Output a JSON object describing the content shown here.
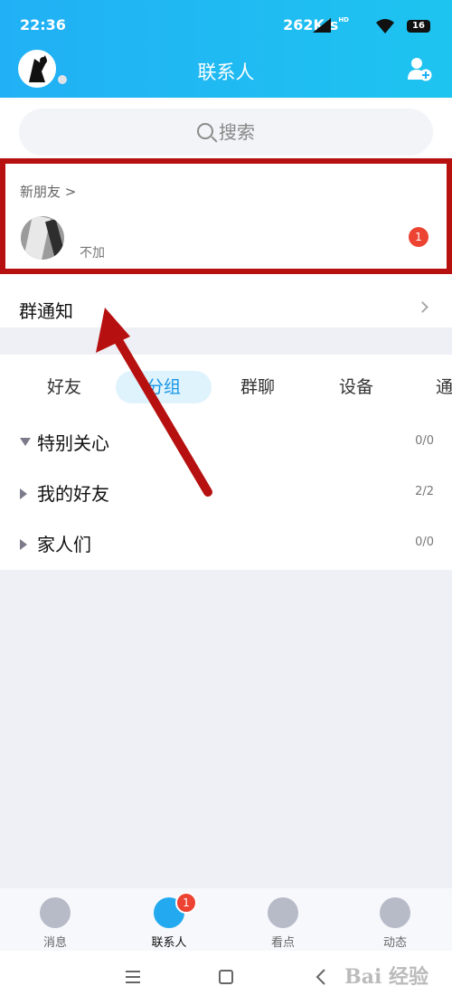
{
  "status_bar": {
    "time": "22:36",
    "speed": "262K/s",
    "hd": "HD",
    "battery": "16"
  },
  "header": {
    "title": "联系人"
  },
  "search": {
    "placeholder": "搜索"
  },
  "new_friends": {
    "label": "新朋友 >",
    "note": "不加",
    "badge": "1"
  },
  "group_notice": {
    "label": "群通知"
  },
  "tabs": [
    {
      "label": "好友",
      "active": false
    },
    {
      "label": "分组",
      "active": true
    },
    {
      "label": "群聊",
      "active": false
    },
    {
      "label": "设备",
      "active": false
    },
    {
      "label": "通",
      "active": false
    }
  ],
  "groups": [
    {
      "name": "特别关心",
      "count": "0/0",
      "expanded": true
    },
    {
      "name": "我的好友",
      "count": "2/2",
      "expanded": false
    },
    {
      "name": "家人们",
      "count": "0/0",
      "expanded": false
    }
  ],
  "bottom_nav": [
    {
      "label": "消息",
      "icon": "chat-smile-icon",
      "active": false
    },
    {
      "label": "联系人",
      "icon": "contacts-icon",
      "active": true,
      "badge": "1"
    },
    {
      "label": "看点",
      "icon": "eye-icon",
      "active": false
    },
    {
      "label": "动态",
      "icon": "planet-star-icon",
      "active": false
    }
  ],
  "system_nav": {
    "menu_icon": "menu-lines-icon",
    "home_icon": "square-home-icon",
    "back_icon": "back-chevron-icon"
  },
  "watermark": {
    "text": "Bai 经验"
  },
  "colors": {
    "header": "#21b0f5",
    "highlight_box": "#b71010",
    "badge": "#ec4332"
  }
}
